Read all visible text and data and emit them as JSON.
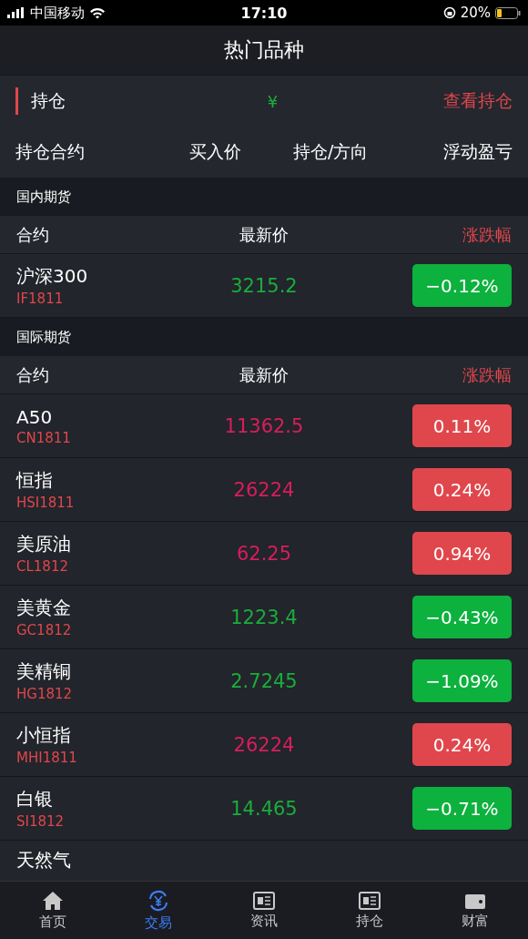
{
  "status_bar": {
    "carrier": "中国移动",
    "time": "17:10",
    "battery": "20%"
  },
  "nav": {
    "title": "热门品种"
  },
  "holdings": {
    "title": "持仓",
    "currency": "¥",
    "link": "查看持仓",
    "columns": [
      "持仓合约",
      "买入价",
      "持仓/方向",
      "浮动盈亏"
    ]
  },
  "sections": [
    {
      "title": "国内期货",
      "columns": [
        "合约",
        "最新价",
        "涨跌幅"
      ],
      "rows": [
        {
          "name": "沪深300",
          "code": "IF1811",
          "price": "3215.2",
          "change": "−0.12%",
          "kind": "down"
        }
      ]
    },
    {
      "title": "国际期货",
      "columns": [
        "合约",
        "最新价",
        "涨跌幅"
      ],
      "rows": [
        {
          "name": "A50",
          "code": "CN1811",
          "price": "11362.5",
          "change": "0.11%",
          "kind": "up"
        },
        {
          "name": "恒指",
          "code": "HSI1811",
          "price": "26224",
          "change": "0.24%",
          "kind": "up"
        },
        {
          "name": "美原油",
          "code": "CL1812",
          "price": "62.25",
          "change": "0.94%",
          "kind": "up"
        },
        {
          "name": "美黄金",
          "code": "GC1812",
          "price": "1223.4",
          "change": "−0.43%",
          "kind": "down"
        },
        {
          "name": "美精铜",
          "code": "HG1812",
          "price": "2.7245",
          "change": "−1.09%",
          "kind": "down"
        },
        {
          "name": "小恒指",
          "code": "MHI1811",
          "price": "26224",
          "change": "0.24%",
          "kind": "up"
        },
        {
          "name": "白银",
          "code": "SI1812",
          "price": "14.465",
          "change": "−0.71%",
          "kind": "down"
        }
      ]
    }
  ],
  "partial_row": {
    "name": "天然气"
  },
  "tabs": [
    {
      "label": "首页",
      "selected": false
    },
    {
      "label": "交易",
      "selected": true
    },
    {
      "label": "资讯",
      "selected": false
    },
    {
      "label": "持仓",
      "selected": false
    },
    {
      "label": "财富",
      "selected": false
    }
  ]
}
